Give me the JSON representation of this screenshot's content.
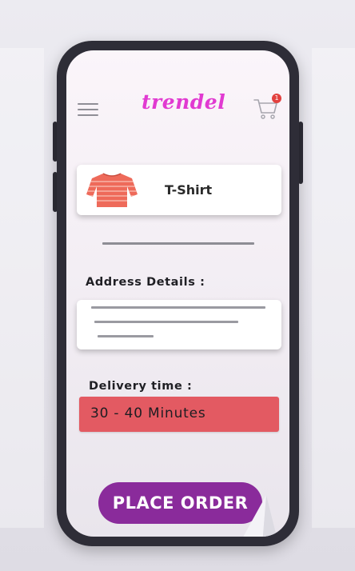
{
  "header": {
    "brand_logo": "trendel",
    "cart_count": "1",
    "menu_icon": "hamburger-icon",
    "cart_icon": "cart-icon"
  },
  "product": {
    "name": "T-Shirt",
    "icon": "tshirt-icon",
    "icon_color": "#ee6a5a"
  },
  "address": {
    "heading": "Address Details :"
  },
  "delivery": {
    "heading": "Delivery time :",
    "value": "30 - 40 Minutes",
    "color": "#e35a62"
  },
  "actions": {
    "place_order_label": "PLACE ORDER",
    "place_order_color": "#8a2b9b"
  },
  "overlay": {
    "icon": "paper-plane-icon"
  }
}
